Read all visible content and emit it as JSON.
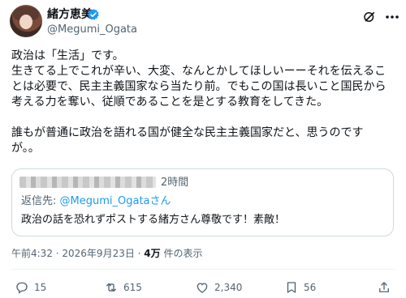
{
  "author": {
    "name": "緒方恵美",
    "handle": "@Megumi_Ogata"
  },
  "post": {
    "line1": "政治は「生活」です。",
    "line2": "生きてる上でこれが辛い、大変、なんとかしてほしいーーそれを伝えるこ",
    "line3": "とは必要で、民主主義国家なら当たり前。でもこの国は長いこと国民から",
    "line4": "考える力を奪い、従順であることを是とする教育をしてきた。",
    "line5": "誰もが普通に政治を語れる国が健全な民主主義国家だと、思うのです",
    "line6": "が。。"
  },
  "quote": {
    "time": "2時間",
    "reply_prefix": "返信先: ",
    "reply_handle": "@Megumi_Ogataさん",
    "text": "政治の話を恐れずポストする緒方さん尊敬です！素敵！"
  },
  "meta": {
    "timestamp": "午前4:32 · 2026年9月23日 · ",
    "views_count": "4万",
    "views_suffix": " 件の表示"
  },
  "actions": {
    "replies": "15",
    "reposts": "615",
    "likes": "2,340",
    "bookmarks": "56"
  },
  "colors": {
    "accent": "#1d9bf0",
    "text": "#0f1419",
    "secondary": "#536471",
    "border": "#cfd9de"
  },
  "icons": [
    "verified-badge-icon",
    "grok-icon",
    "more-icon",
    "reply-icon",
    "repost-icon",
    "like-icon",
    "bookmark-icon",
    "share-icon"
  ]
}
